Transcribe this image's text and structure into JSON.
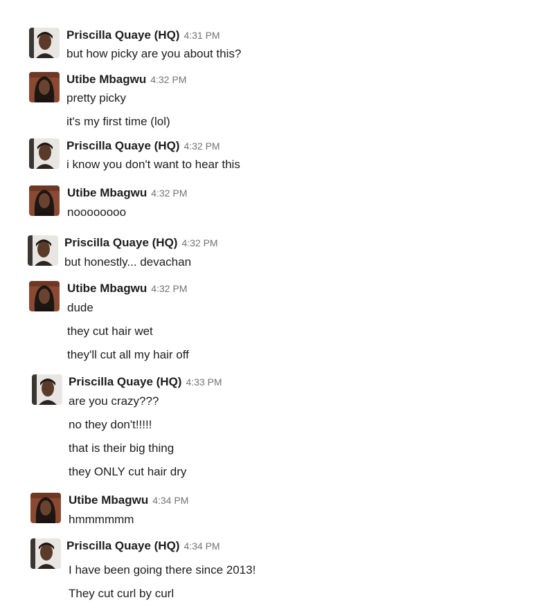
{
  "icons": {
    "priscilla_avatar": "avatar-priscilla-icon",
    "utibe_avatar": "avatar-utibe-icon"
  },
  "messages": [
    {
      "author": "Priscilla Quaye (HQ)",
      "time": "4:31 PM",
      "lines": [
        "but how picky are you about this?"
      ]
    },
    {
      "author": "Utibe Mbagwu",
      "time": "4:32 PM",
      "lines": [
        "pretty picky",
        "it's my first time (lol)"
      ]
    },
    {
      "author": "Priscilla Quaye (HQ)",
      "time": "4:32 PM",
      "lines": [
        "i know you don't want to hear this"
      ]
    },
    {
      "author": "Utibe Mbagwu",
      "time": "4:32 PM",
      "lines": [
        "noooooooo"
      ]
    },
    {
      "author": "Priscilla Quaye (HQ)",
      "time": "4:32 PM",
      "lines": [
        "but honestly... devachan"
      ]
    },
    {
      "author": "Utibe Mbagwu",
      "time": "4:32 PM",
      "lines": [
        "dude",
        "they cut hair wet",
        "they'll cut all my hair off"
      ]
    },
    {
      "author": "Priscilla Quaye (HQ)",
      "time": "4:33 PM",
      "lines": [
        "are you crazy???",
        "no they don't!!!!!",
        "that is their big thing",
        "they ONLY cut hair dry"
      ]
    },
    {
      "author": "Utibe Mbagwu",
      "time": "4:34 PM",
      "lines": [
        "hmmmmmm"
      ]
    },
    {
      "author": "Priscilla Quaye (HQ)",
      "time": "4:34 PM",
      "lines": [
        "I have been going there since 2013!",
        "They cut curl by curl"
      ]
    }
  ]
}
